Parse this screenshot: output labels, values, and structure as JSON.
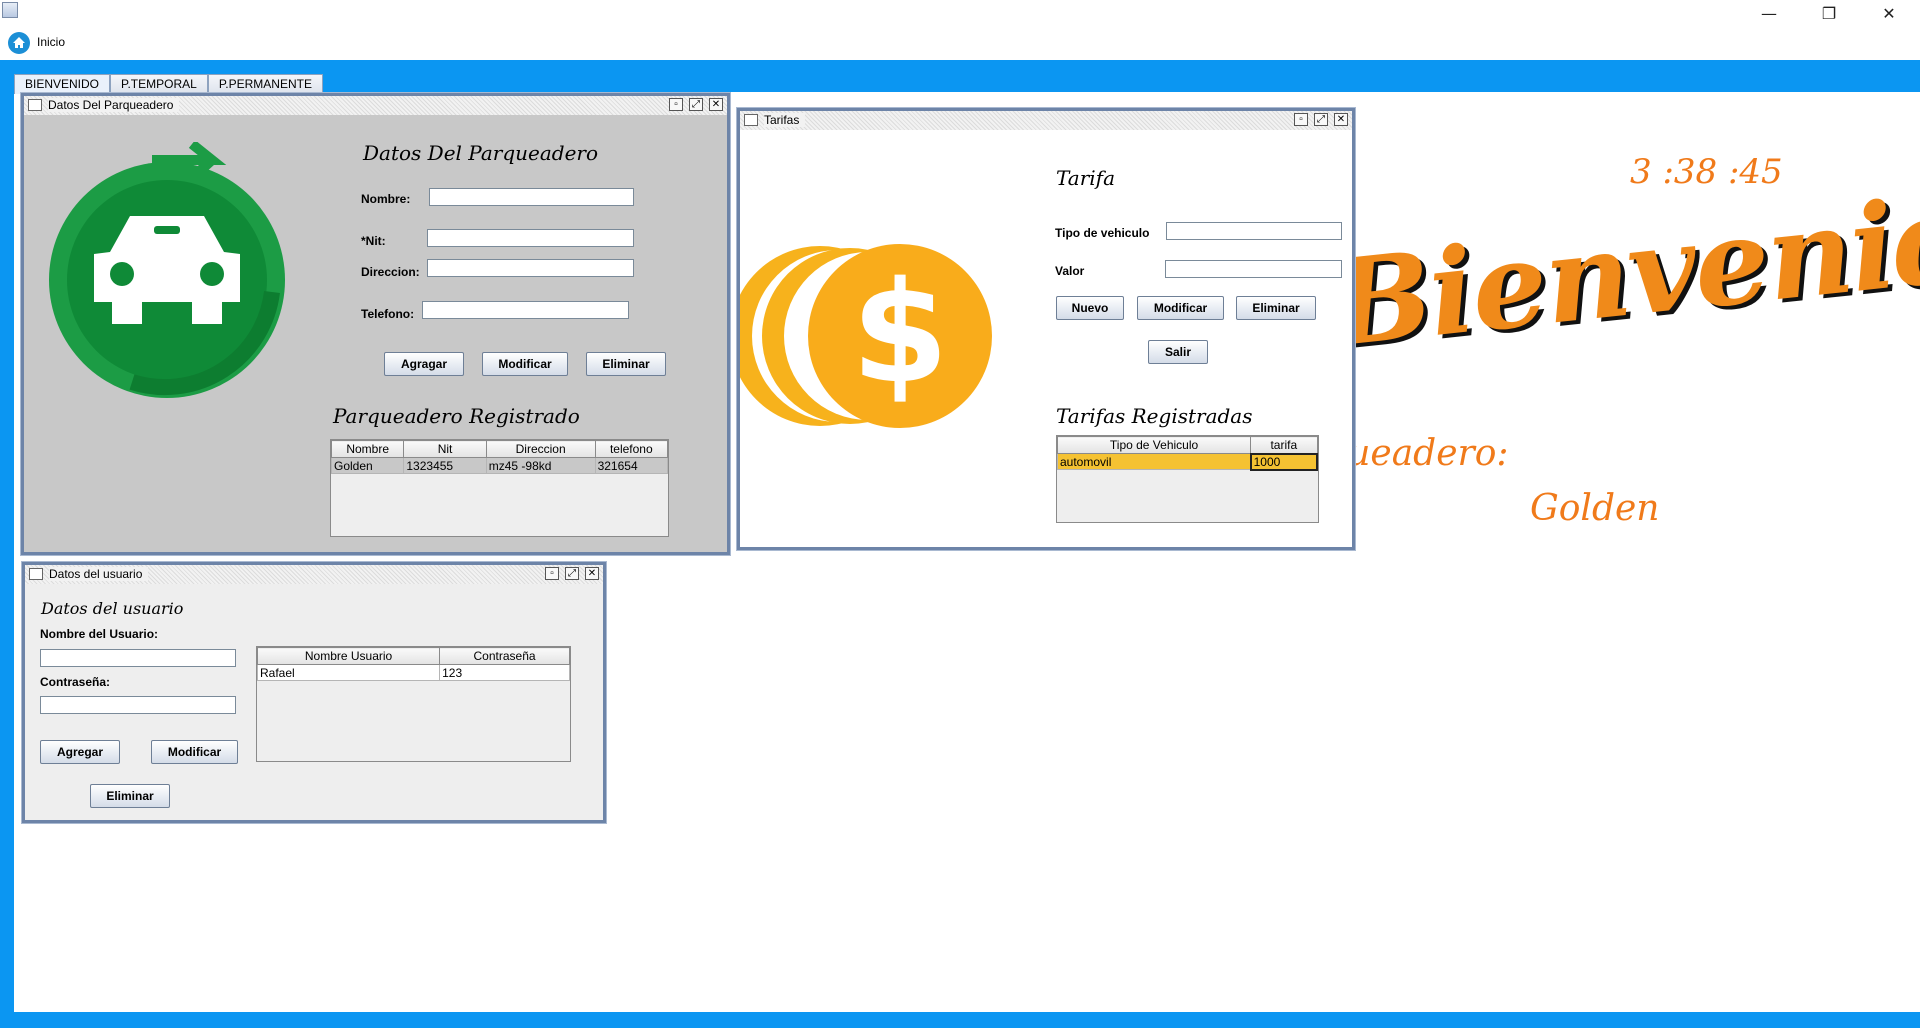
{
  "menu": {
    "inicio": "Inicio"
  },
  "window_controls": {
    "minimize": "—",
    "restore": "❐",
    "close": "✕"
  },
  "tabs": [
    "BIENVENIDO",
    "P.TEMPORAL",
    "P.PERMANENTE"
  ],
  "welcome": {
    "clock": "3   :38 :45",
    "greeting": "Bienvenido!",
    "parking_label": "rueadero:",
    "parking_name": "Golden"
  },
  "parqueadero": {
    "window_title": "Datos Del Parqueadero",
    "heading": "Datos Del Parqueadero",
    "labels": {
      "nombre": "Nombre:",
      "nit": "*Nit:",
      "direccion": "Direccion:",
      "telefono": "Telefono:"
    },
    "buttons": {
      "agregar": "Agragar",
      "modificar": "Modificar",
      "eliminar": "Eliminar"
    },
    "table_heading": "Parqueadero Registrado",
    "columns": [
      "Nombre",
      "Nit",
      "Direccion",
      "telefono"
    ],
    "rows": [
      [
        "Golden",
        "1323455",
        "mz45 -98kd",
        "321654"
      ]
    ]
  },
  "tarifas": {
    "window_title": "Tarifas",
    "heading": "Tarifa",
    "labels": {
      "tipo": "Tipo de vehiculo",
      "valor": "Valor"
    },
    "buttons": {
      "nuevo": "Nuevo",
      "modificar": "Modificar",
      "eliminar": "Eliminar",
      "salir": "Salir"
    },
    "table_heading": "Tarifas Registradas",
    "columns": [
      "Tipo de Vehiculo",
      "tarifa"
    ],
    "rows": [
      [
        "automovil",
        "1000"
      ]
    ]
  },
  "usuario": {
    "window_title": "Datos del usuario",
    "heading": "Datos  del usuario",
    "labels": {
      "nombre": "Nombre del Usuario:",
      "contrasena": "Contraseña:"
    },
    "buttons": {
      "agregar": "Agregar",
      "modificar": "Modificar",
      "eliminar": "Eliminar"
    },
    "columns": [
      "Nombre Usuario",
      "Contraseña"
    ],
    "rows": [
      [
        "Rafael",
        "123"
      ]
    ]
  },
  "colors": {
    "accent_blue": "#0b96f2",
    "orange": "#f07a1a",
    "green": "#1a8f3a",
    "selection": "#f5c232"
  }
}
